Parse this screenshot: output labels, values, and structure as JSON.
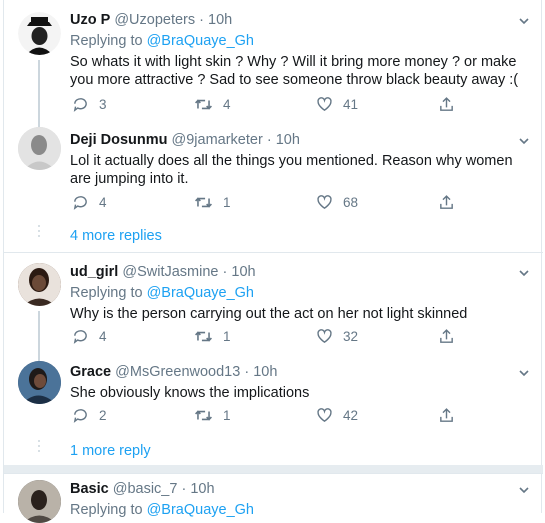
{
  "tweets": [
    {
      "name": "Uzo P",
      "handle": "@Uzopeters",
      "time": "10h",
      "replying_label": "Replying to",
      "replying_to": "@BraQuaye_Gh",
      "text": "So whats it with light skin ? Why ? Will it bring more money ? or make you more attractive ? Sad to see someone throw black beauty away :(",
      "replies": "3",
      "retweets": "4",
      "likes": "41"
    },
    {
      "name": "Deji Dosunmu",
      "handle": "@9jamarketer",
      "time": "10h",
      "text": "Lol it actually does all the things you mentioned. Reason why women are jumping into it.",
      "replies": "4",
      "retweets": "1",
      "likes": "68"
    },
    {
      "name": "ud_girl",
      "handle": "@SwitJasmine",
      "time": "10h",
      "replying_label": "Replying to",
      "replying_to": "@BraQuaye_Gh",
      "text": "Why is the person carrying out the act on her not light skinned",
      "replies": "4",
      "retweets": "1",
      "likes": "32"
    },
    {
      "name": "Grace",
      "handle": "@MsGreenwood13",
      "time": "10h",
      "text": "She obviously knows the implications",
      "replies": "2",
      "retweets": "1",
      "likes": "42"
    },
    {
      "name": "Basic",
      "handle": "@basic_7",
      "time": "10h",
      "replying_label": "Replying to",
      "replying_to": "@BraQuaye_Gh"
    }
  ],
  "more_replies": [
    "4 more replies",
    "1 more reply"
  ],
  "colors": {
    "accent": "#1da1f2",
    "secondary": "#657786",
    "text": "#14171a",
    "border": "#e1e8ed"
  }
}
